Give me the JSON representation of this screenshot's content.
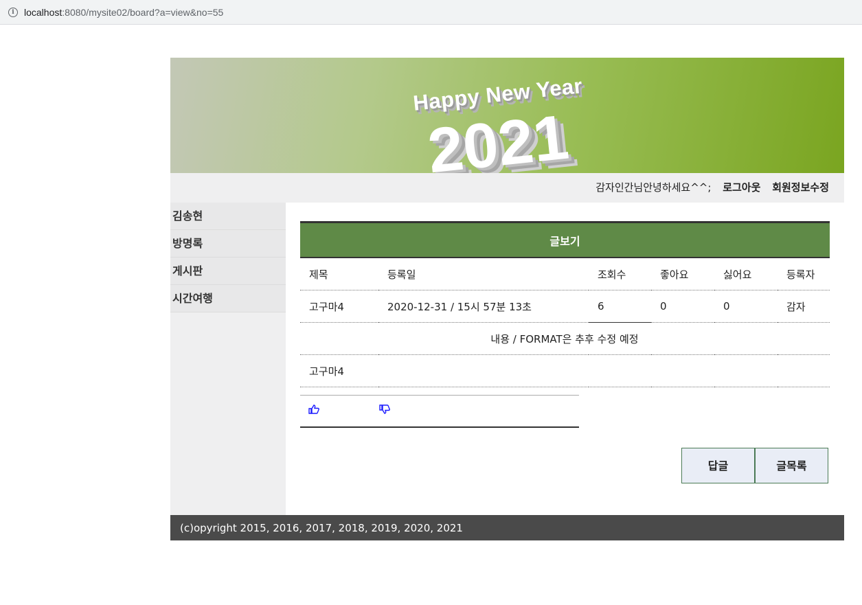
{
  "browser": {
    "url_host": "localhost",
    "url_rest": ":8080/mysite02/board?a=view&no=55"
  },
  "banner": {
    "headline": "Happy New Year",
    "year": "2021"
  },
  "topnav": {
    "greeting": "감자인간님안녕하세요^^;",
    "logout": "로그아웃",
    "edit_profile": "회원정보수정"
  },
  "sidebar": {
    "items": [
      {
        "label": "김송현"
      },
      {
        "label": "방명록"
      },
      {
        "label": "게시판"
      },
      {
        "label": "시간여행"
      }
    ]
  },
  "board": {
    "title": "글보기",
    "headers": [
      "제목",
      "등록일",
      "조회수",
      "좋아요",
      "싫어요",
      "등록자"
    ],
    "row": {
      "title": "고구마4",
      "date": "2020-12-31 / 15시 57분 13초",
      "views": "6",
      "likes": "0",
      "dislikes": "0",
      "author": "감자"
    },
    "notice": "내용 / FORMAT은 추후 수정 예정",
    "content": "고구마4",
    "like_icon": "thumbs-up-icon",
    "dislike_icon": "thumbs-down-icon",
    "reply_button": "답글",
    "list_button": "글목록"
  },
  "footer": {
    "copyright": "(c)opyright 2015, 2016, 2017, 2018, 2019, 2020, 2021"
  }
}
